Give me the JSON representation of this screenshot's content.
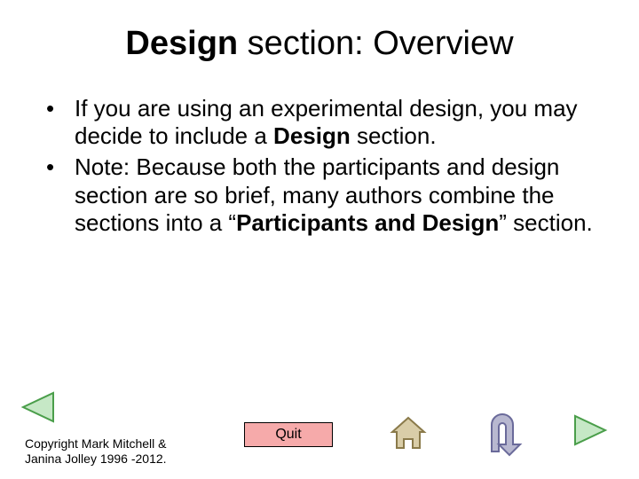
{
  "title": {
    "bold": "Design",
    "rest": " section: Overview"
  },
  "bullets": [
    {
      "parts": [
        {
          "t": "If you are using an experimental design, you may decide to include a ",
          "b": false
        },
        {
          "t": "Design",
          "b": true
        },
        {
          "t": " section.",
          "b": false
        }
      ]
    },
    {
      "parts": [
        {
          "t": "Note: Because both the participants and design section are so brief, many authors combine the sections into a “",
          "b": false
        },
        {
          "t": "Participants and Design",
          "b": true
        },
        {
          "t": "” section.",
          "b": false
        }
      ]
    }
  ],
  "footer": {
    "copyright_l1": "Copyright Mark Mitchell &",
    "copyright_l2": "Janina Jolley 1996 -2012.",
    "quit_label": "Quit"
  },
  "colors": {
    "quit_bg": "#f6aaaa",
    "arrow_fill": "#c6e8c6",
    "arrow_stroke": "#4a9e4a",
    "home_fill": "#d9cda8",
    "home_stroke": "#8a7a4a",
    "return_fill": "#b8b8d0",
    "return_stroke": "#6a6a9a"
  }
}
